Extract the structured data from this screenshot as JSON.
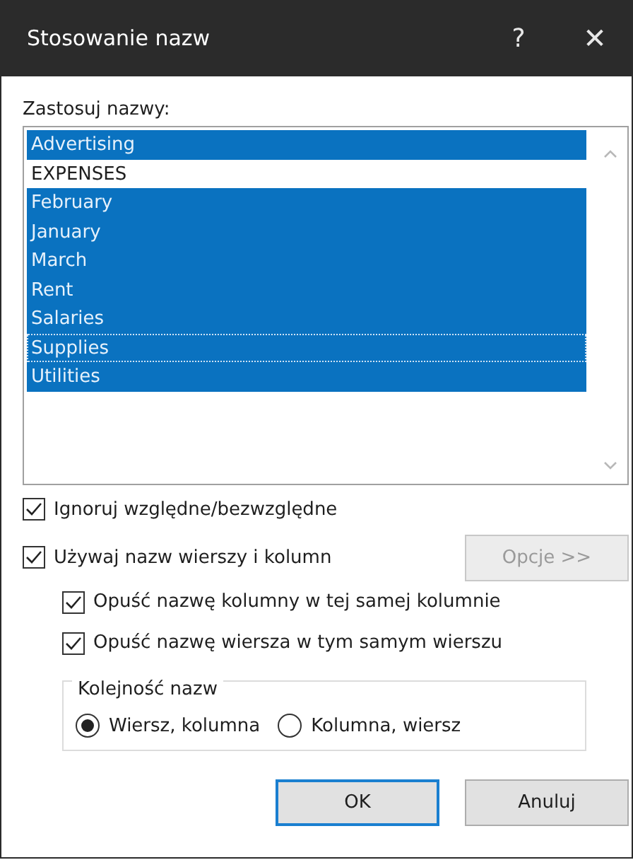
{
  "window": {
    "title": "Stosowanie nazw",
    "help": "?",
    "close": "✕"
  },
  "names_list": {
    "label": "Zastosuj nazwy:",
    "items": [
      {
        "text": "Advertising",
        "selected": true,
        "focused": false
      },
      {
        "text": "EXPENSES",
        "selected": false,
        "focused": false
      },
      {
        "text": "February",
        "selected": true,
        "focused": false
      },
      {
        "text": "January",
        "selected": true,
        "focused": false
      },
      {
        "text": "March",
        "selected": true,
        "focused": false
      },
      {
        "text": "Rent",
        "selected": true,
        "focused": false
      },
      {
        "text": "Salaries",
        "selected": true,
        "focused": false
      },
      {
        "text": "Supplies",
        "selected": true,
        "focused": true
      },
      {
        "text": "Utilities",
        "selected": true,
        "focused": false
      }
    ]
  },
  "options": [
    {
      "label": "Ignoruj względne/bezwzględne",
      "checked": true,
      "indented": false
    },
    {
      "label": "Używaj nazw wierszy i kolumn",
      "checked": true,
      "indented": false,
      "button": {
        "label": "Opcje >>",
        "disabled": true
      }
    },
    {
      "label": "Opuść nazwę kolumny w tej samej kolumnie",
      "checked": true,
      "indented": true
    },
    {
      "label": "Opuść nazwę wiersza w tym samym wierszu",
      "checked": true,
      "indented": true
    }
  ],
  "name_order": {
    "legend": "Kolejność nazw",
    "radios": [
      {
        "label": "Wiersz, kolumna",
        "selected": true
      },
      {
        "label": "Kolumna, wiersz",
        "selected": false
      }
    ]
  },
  "buttons": [
    {
      "label": "OK",
      "default": true
    },
    {
      "label": "Anuluj",
      "default": false
    }
  ]
}
